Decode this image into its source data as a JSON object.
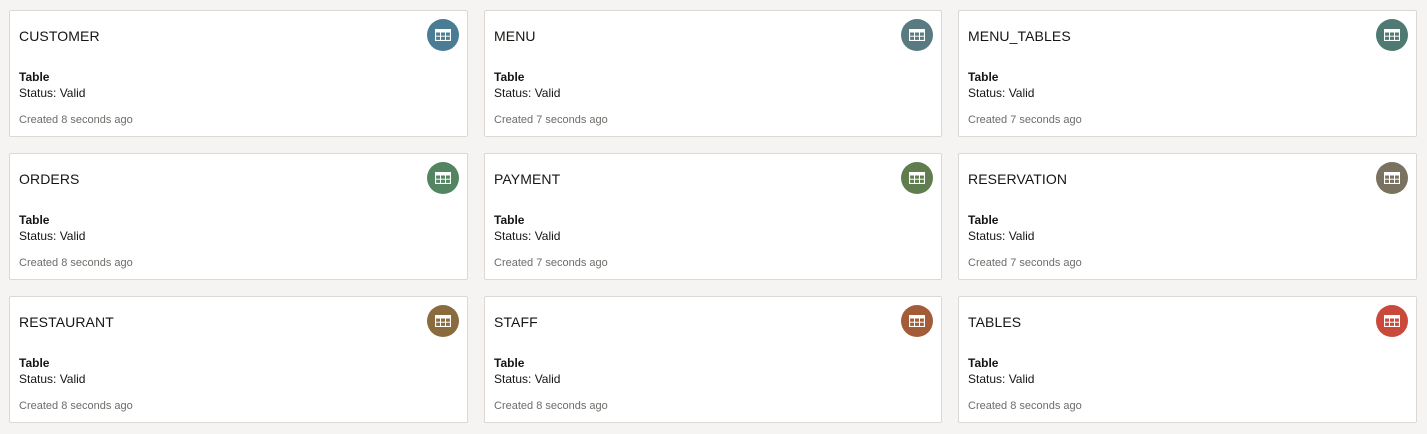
{
  "cards": [
    {
      "title": "CUSTOMER",
      "type": "Table",
      "status": "Status: Valid",
      "created": "Created 8 seconds ago",
      "icon": "table-icon",
      "color": "#4a7c94"
    },
    {
      "title": "MENU",
      "type": "Table",
      "status": "Status: Valid",
      "created": "Created 7 seconds ago",
      "icon": "table-icon",
      "color": "#5a7a82"
    },
    {
      "title": "MENU_TABLES",
      "type": "Table",
      "status": "Status: Valid",
      "created": "Created 7 seconds ago",
      "icon": "table-icon",
      "color": "#4f7a74"
    },
    {
      "title": "ORDERS",
      "type": "Table",
      "status": "Status: Valid",
      "created": "Created 8 seconds ago",
      "icon": "table-icon",
      "color": "#538562"
    },
    {
      "title": "PAYMENT",
      "type": "Table",
      "status": "Status: Valid",
      "created": "Created 7 seconds ago",
      "icon": "table-icon",
      "color": "#5f7d4f"
    },
    {
      "title": "RESERVATION",
      "type": "Table",
      "status": "Status: Valid",
      "created": "Created 7 seconds ago",
      "icon": "table-icon",
      "color": "#7a7260"
    },
    {
      "title": "RESTAURANT",
      "type": "Table",
      "status": "Status: Valid",
      "created": "Created 8 seconds ago",
      "icon": "table-icon",
      "color": "#8a6b3e"
    },
    {
      "title": "STAFF",
      "type": "Table",
      "status": "Status: Valid",
      "created": "Created 8 seconds ago",
      "icon": "table-icon",
      "color": "#a35c37"
    },
    {
      "title": "TABLES",
      "type": "Table",
      "status": "Status: Valid",
      "created": "Created 8 seconds ago",
      "icon": "table-icon",
      "color": "#c9493a"
    }
  ]
}
